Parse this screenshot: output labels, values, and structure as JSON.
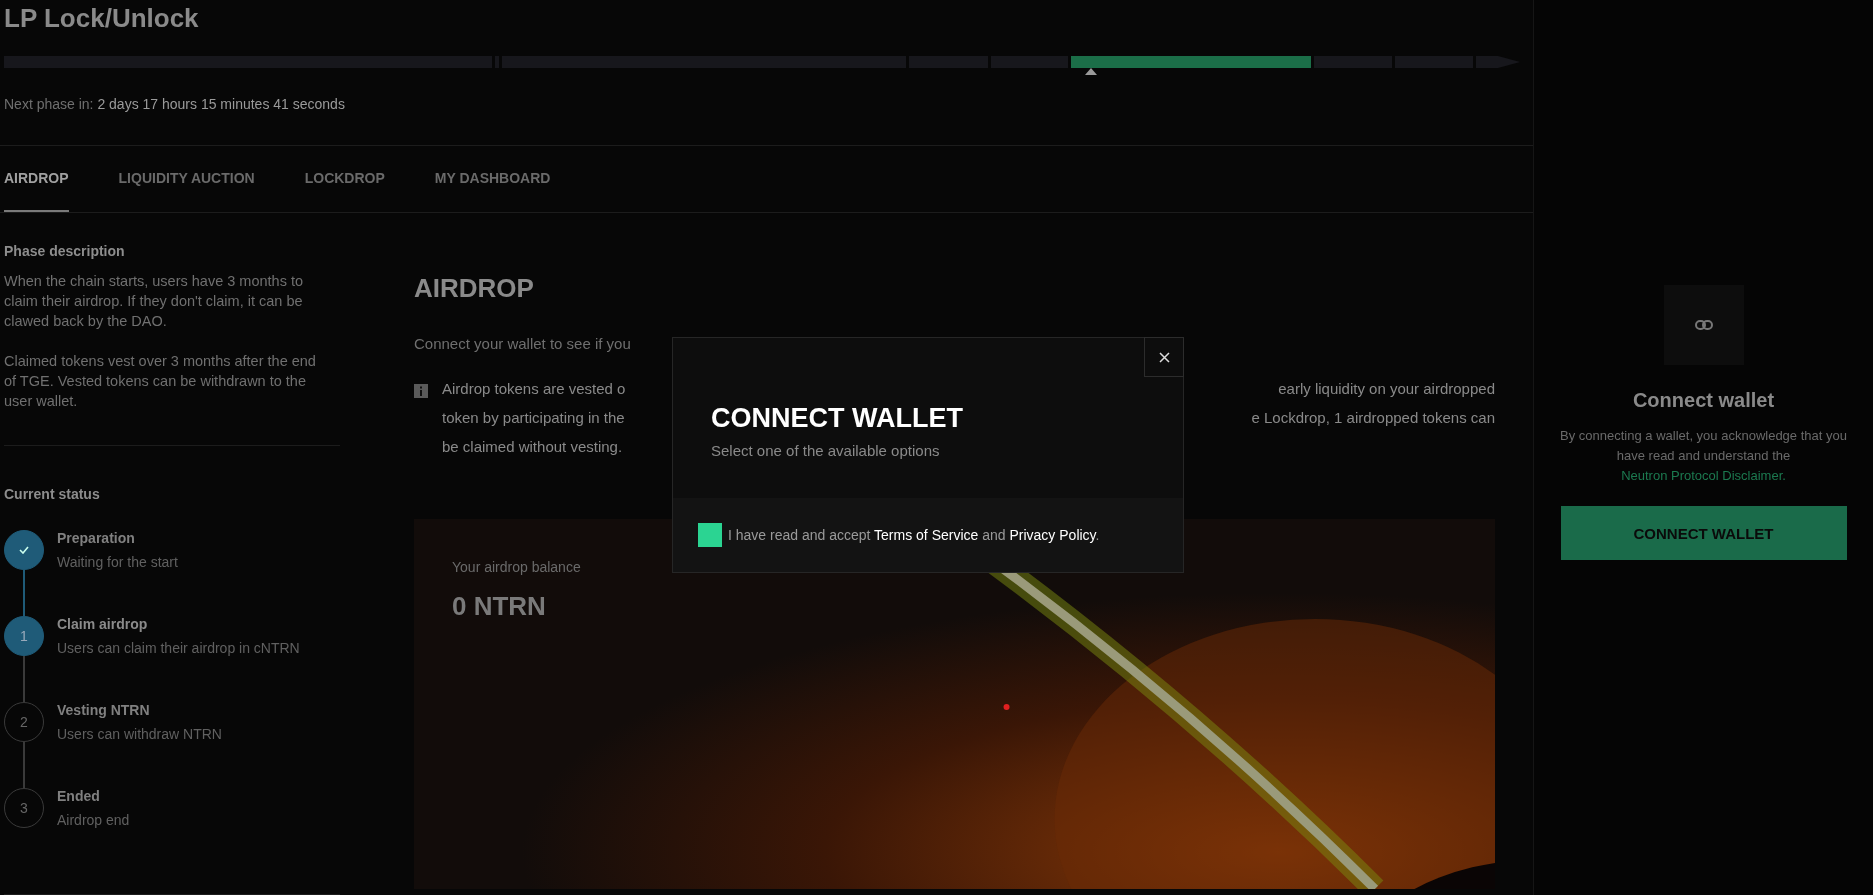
{
  "page_title": "LP Lock/Unlock",
  "phase_bar": {
    "segments": [
      {
        "selected": false
      },
      {
        "selected": false
      },
      {
        "selected": false
      },
      {
        "selected": false
      },
      {
        "selected": false
      },
      {
        "selected": true
      },
      {
        "selected": false
      },
      {
        "selected": false
      },
      {
        "selected": false
      }
    ]
  },
  "next_phase": {
    "label": "Next phase in:",
    "value": "2 days 17 hours 15 minutes 41 seconds"
  },
  "tabs": [
    {
      "label": "AIRDROP",
      "selected": true
    },
    {
      "label": "LIQUIDITY AUCTION",
      "selected": false
    },
    {
      "label": "LOCKDROP",
      "selected": false
    },
    {
      "label": "MY DASHBOARD",
      "selected": false
    }
  ],
  "sidebar": {
    "description_title": "Phase description",
    "description": [
      "When the chain starts, users have 3 months to claim their airdrop. If they don't claim, it can be clawed back by the DAO.",
      "Claimed tokens vest over 3 months after the end of TGE. Vested tokens can be withdrawn to the user wallet."
    ],
    "status_title": "Current status",
    "steps": [
      {
        "completed": true,
        "current": false,
        "title": "Preparation",
        "subtitle": "Waiting for the start"
      },
      {
        "completed": false,
        "current": true,
        "marker": "1",
        "title": "Claim airdrop",
        "subtitle": "Users can claim their airdrop in cNTRN"
      },
      {
        "completed": false,
        "current": false,
        "marker": "2",
        "title": "Vesting NTRN",
        "subtitle": "Users can withdraw NTRN"
      },
      {
        "completed": false,
        "current": false,
        "marker": "3",
        "title": "Ended",
        "subtitle": "Airdrop end"
      }
    ]
  },
  "content": {
    "title": "AIRDROP",
    "intro": "Connect your wallet to see if you",
    "notice_lines": [
      {
        "left": "Airdrop tokens are vested o",
        "right": "early liquidity on your airdropped"
      },
      {
        "left": "token by participating in the",
        "right": "e Lockdrop, 1 airdropped tokens can"
      },
      {
        "left": "be claimed without vesting."
      }
    ],
    "balance": {
      "label": "Your airdrop balance",
      "value": "0 NTRN"
    }
  },
  "modal": {
    "title": "CONNECT WALLET",
    "subtitle": "Select one of the available options",
    "checkbox": {
      "checked": false
    },
    "consent": [
      "I have read and accept ",
      "Terms of Service",
      " and ",
      "Privacy Policy",
      "."
    ]
  },
  "wallet_panel": {
    "title": "Connect wallet",
    "text": "By connecting a wallet, you acknowledge that you have read and understand the",
    "link": "Neutron Protocol Disclaimer.",
    "button": "CONNECT WALLET"
  }
}
